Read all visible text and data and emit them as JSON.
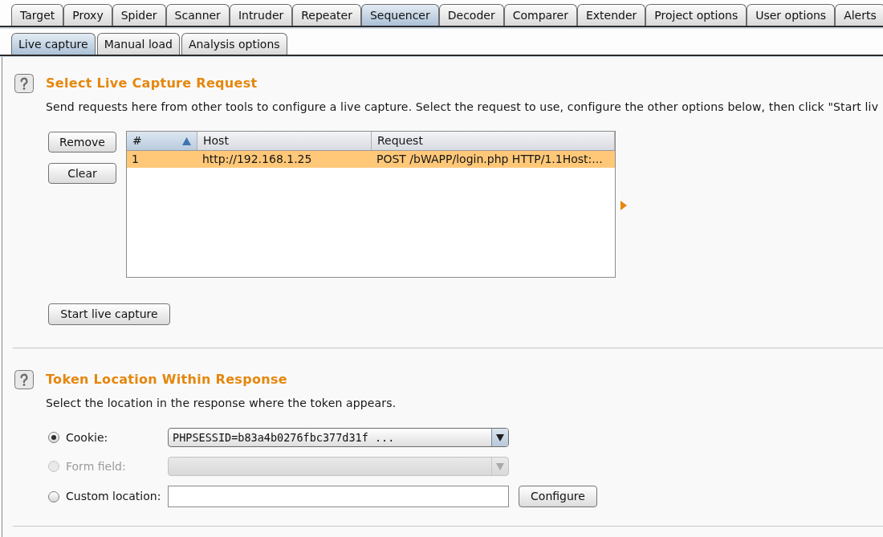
{
  "main_tabs": [
    {
      "label": "Target",
      "selected": false
    },
    {
      "label": "Proxy",
      "selected": false
    },
    {
      "label": "Spider",
      "selected": false
    },
    {
      "label": "Scanner",
      "selected": false
    },
    {
      "label": "Intruder",
      "selected": false
    },
    {
      "label": "Repeater",
      "selected": false
    },
    {
      "label": "Sequencer",
      "selected": true
    },
    {
      "label": "Decoder",
      "selected": false
    },
    {
      "label": "Comparer",
      "selected": false
    },
    {
      "label": "Extender",
      "selected": false
    },
    {
      "label": "Project options",
      "selected": false
    },
    {
      "label": "User options",
      "selected": false
    },
    {
      "label": "Alerts",
      "selected": false
    }
  ],
  "sub_tabs": [
    {
      "label": "Live capture",
      "selected": true
    },
    {
      "label": "Manual load",
      "selected": false
    },
    {
      "label": "Analysis options",
      "selected": false
    }
  ],
  "capture_request": {
    "title": "Select Live Capture Request",
    "description": "Send requests here from other tools to configure a live capture. Select the request to use, configure the other options below, then click \"Start liv",
    "side_buttons": [
      "Remove",
      "Clear"
    ],
    "table": {
      "columns": [
        {
          "label": "#",
          "sorted": true
        },
        {
          "label": "Host",
          "sorted": false
        },
        {
          "label": "Request",
          "sorted": false
        }
      ],
      "rows": [
        {
          "cells": [
            "1",
            "http://192.168.1.25",
            "POST /bWAPP/login.php HTTP/1.1Host:..."
          ],
          "selected": true
        }
      ]
    },
    "start_button": "Start live capture"
  },
  "token_location": {
    "title": "Token Location Within Response",
    "description": "Select the location in the response where the token appears.",
    "options": [
      {
        "kind": "dropdown",
        "label": "Cookie:",
        "selected": true,
        "disabled": false,
        "value": "PHPSESSID=b83a4b0276fbc377d31f ..."
      },
      {
        "kind": "dropdown",
        "label": "Form field:",
        "selected": false,
        "disabled": true
      },
      {
        "kind": "text_field",
        "label": "Custom location:",
        "selected": false,
        "disabled": false,
        "button": "Configure"
      }
    ]
  }
}
